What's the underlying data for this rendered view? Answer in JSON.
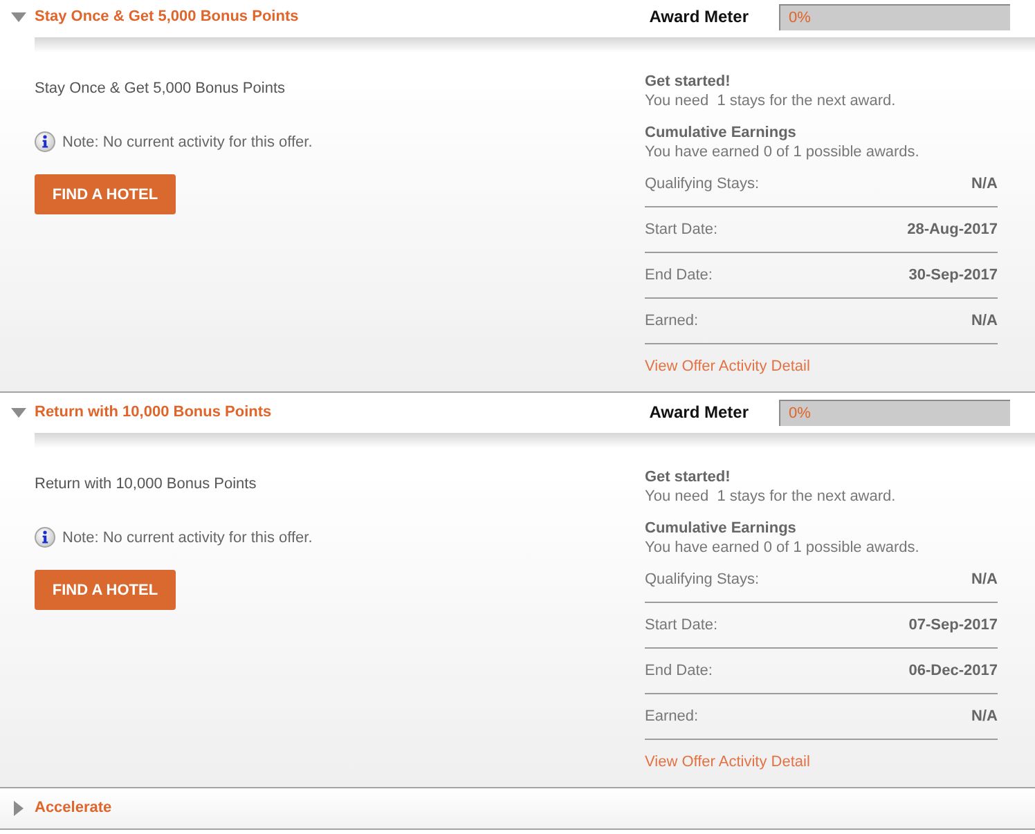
{
  "offers": [
    {
      "title": "Stay Once & Get 5,000 Bonus Points",
      "expanded": true,
      "meter_label": "Award Meter",
      "meter_reading": "0%",
      "description": "Stay Once & Get 5,000 Bonus Points",
      "note": "Note: No current activity for this offer.",
      "button": "FIND A HOTEL",
      "status_heading": "Get started!",
      "status_text": "You need  1 stays for the next award.",
      "earnings_heading": "Cumulative Earnings",
      "earnings_text": "You have earned 0 of 1 possible awards.",
      "details": [
        {
          "label": "Qualifying Stays:",
          "value": "N/A"
        },
        {
          "label": "Start Date:",
          "value": "28-Aug-2017"
        },
        {
          "label": "End Date:",
          "value": "30-Sep-2017"
        },
        {
          "label": "Earned:",
          "value": "N/A"
        }
      ],
      "link": "View Offer Activity Detail"
    },
    {
      "title": "Return with 10,000 Bonus Points",
      "expanded": true,
      "meter_label": "Award Meter",
      "meter_reading": "0%",
      "description": "Return with 10,000 Bonus Points",
      "note": "Note: No current activity for this offer.",
      "button": "FIND A HOTEL",
      "status_heading": "Get started!",
      "status_text": "You need  1 stays for the next award.",
      "earnings_heading": "Cumulative Earnings",
      "earnings_text": "You have earned 0 of 1 possible awards.",
      "details": [
        {
          "label": "Qualifying Stays:",
          "value": "N/A"
        },
        {
          "label": "Start Date:",
          "value": "07-Sep-2017"
        },
        {
          "label": "End Date:",
          "value": "06-Dec-2017"
        },
        {
          "label": "Earned:",
          "value": "N/A"
        }
      ],
      "link": "View Offer Activity Detail"
    },
    {
      "title": "Accelerate",
      "expanded": false
    }
  ]
}
